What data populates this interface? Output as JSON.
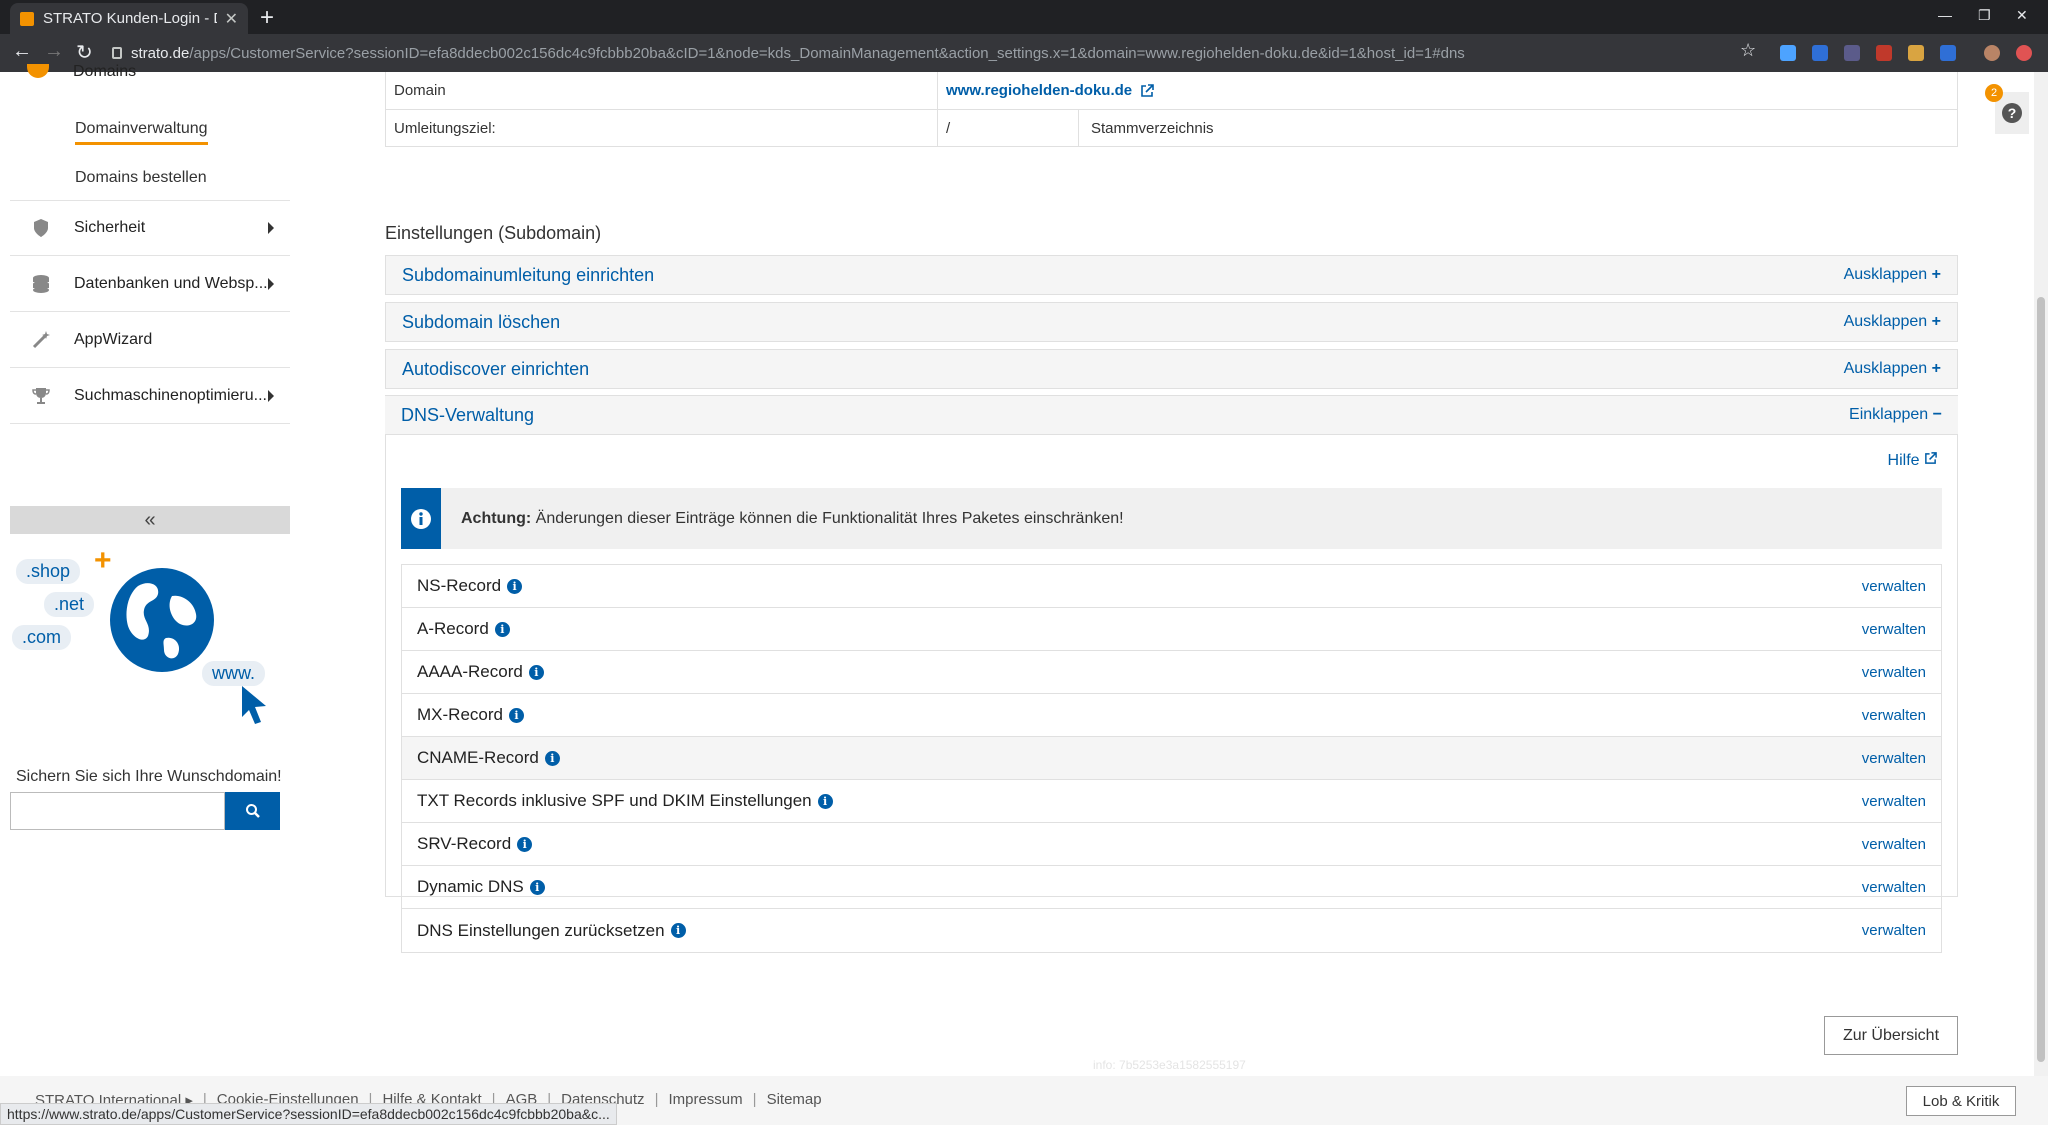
{
  "browser": {
    "tab_title": "STRATO Kunden-Login - D",
    "url_host": "strato.de",
    "url_path": "/apps/CustomerService?sessionID=efa8ddecb002c156dc4c9fcbbb20ba&cID=1&node=kds_DomainManagement&action_settings.x=1&domain=www.regiohelden-doku.de&id=1&host_id=1#dns",
    "status_url": "https://www.strato.de/apps/CustomerService?sessionID=efa8ddecb002c156dc4c9fcbbb20ba&c..."
  },
  "sidebar": {
    "top_item": "Domains",
    "sub_items": [
      "Domainverwaltung",
      "Domains bestellen"
    ],
    "items": [
      {
        "label": "Sicherheit",
        "icon": "shield-icon"
      },
      {
        "label": "Datenbanken und Websp...",
        "icon": "database-icon"
      },
      {
        "label": "AppWizard",
        "icon": "wand-icon"
      },
      {
        "label": "Suchmaschinenoptimieru...",
        "icon": "trophy-icon"
      }
    ],
    "collapse": "«",
    "promo": {
      "tlds": [
        ".shop",
        ".net",
        ".com",
        "www."
      ],
      "text": "Sichern Sie sich Ihre Wunschdomain!"
    }
  },
  "domain_table": {
    "rows": [
      {
        "label": "Domain",
        "value": "www.regiohelden-doku.de"
      },
      {
        "label": "Umleitungsziel:",
        "value": "/",
        "extra": "Stammverzeichnis"
      }
    ]
  },
  "settings": {
    "title": "Einstellungen (Subdomain)",
    "accordions": [
      {
        "title": "Subdomainumleitung einrichten",
        "toggle": "Ausklappen"
      },
      {
        "title": "Subdomain löschen",
        "toggle": "Ausklappen"
      },
      {
        "title": "Autodiscover einrichten",
        "toggle": "Ausklappen"
      }
    ],
    "dns": {
      "title": "DNS-Verwaltung",
      "toggle": "Einklappen",
      "help": "Hilfe",
      "alert_strong": "Achtung:",
      "alert_text": " Änderungen dieser Einträge können die Funktionalität Ihres Paketes einschränken!",
      "records": [
        {
          "label": "NS-Record",
          "action": "verwalten"
        },
        {
          "label": "A-Record",
          "action": "verwalten"
        },
        {
          "label": "AAAA-Record",
          "action": "verwalten"
        },
        {
          "label": "MX-Record",
          "action": "verwalten"
        },
        {
          "label": "CNAME-Record",
          "action": "verwalten"
        },
        {
          "label": "TXT Records inklusive SPF und DKIM Einstellungen",
          "action": "verwalten"
        },
        {
          "label": "SRV-Record",
          "action": "verwalten"
        },
        {
          "label": "Dynamic DNS",
          "action": "verwalten"
        },
        {
          "label": "DNS Einstellungen zurücksetzen",
          "action": "verwalten"
        }
      ]
    }
  },
  "overview_button": "Zur Übersicht",
  "info_id": "info: 7b5253e3a1582555197",
  "help_badge": "2",
  "footer": {
    "links": [
      "STRATO International ▸",
      "Cookie-Einstellungen",
      "Hilfe & Kontakt",
      "AGB",
      "Datenschutz",
      "Impressum",
      "Sitemap"
    ],
    "feedback": "Lob & Kritik"
  },
  "colors": {
    "brand_blue": "#005ea8",
    "accent_orange": "#f39200"
  }
}
